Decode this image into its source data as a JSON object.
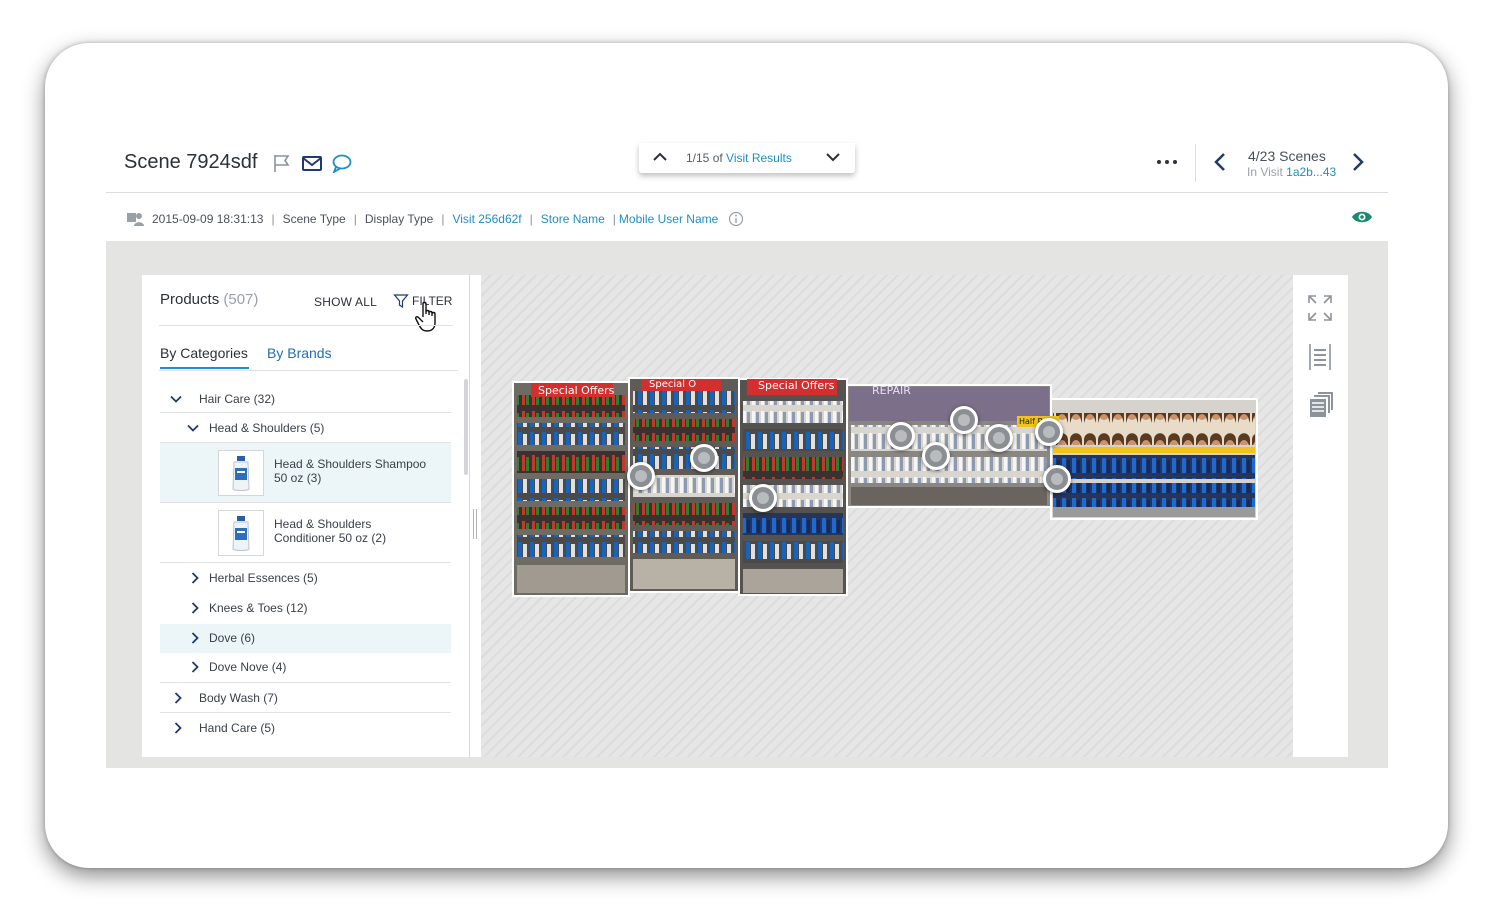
{
  "header": {
    "scene_title": "Scene 7924sdf",
    "results_position": "1/15 of",
    "results_link": "Visit Results",
    "scenes_count": "4/23 Scenes",
    "in_visit_label": "In Visit",
    "visit_short": "1a2b...43"
  },
  "meta": {
    "datetime": "2015-09-09 18:31:13",
    "scene_type": "Scene Type",
    "display_type": "Display Type",
    "visit": "Visit 256d62f",
    "store": "Store Name",
    "user": "Mobile User Name"
  },
  "products": {
    "title": "Products",
    "count": "(507)",
    "show_all": "SHOW ALL",
    "filter": "FILTER",
    "tabs": [
      "By Categories",
      "By Brands"
    ],
    "tree": {
      "hair_care": "Hair Care (32)",
      "head_shoulders": "Head & Shoulders (5)",
      "items": [
        {
          "name": "Head & Shoulders Shampoo 50 oz (3)"
        },
        {
          "name": "Head & Shoulders Conditioner 50 oz (2)"
        }
      ],
      "herbal": "Herbal Essences (5)",
      "knees": "Knees & Toes (12)",
      "dove": "Dove (6)",
      "dove_nove": "Dove Nove (4)",
      "body_wash": "Body Wash (7)",
      "hand_care": "Hand Care (5)"
    }
  },
  "shelf": {
    "labels": [
      "Special Offers",
      "Special O",
      "Special Offers",
      "REPAIR",
      "Half Price"
    ]
  },
  "colors": {
    "accent": "#1f8ec5",
    "eye": "#1a8a6e",
    "highlight": "#ecf6f8"
  }
}
